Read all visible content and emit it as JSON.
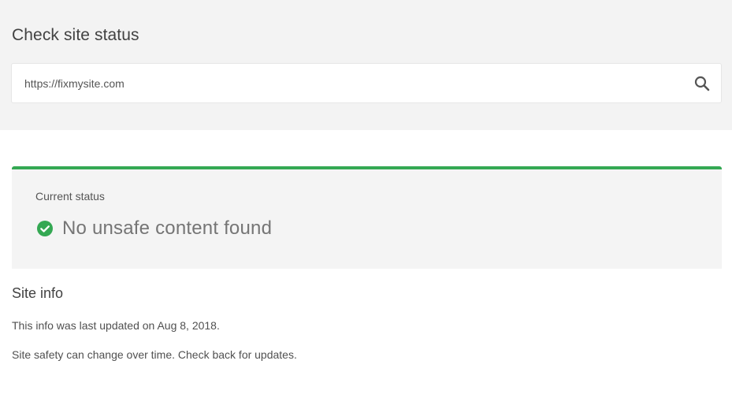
{
  "search": {
    "title": "Check site status",
    "value": "https://fixmysite.com",
    "icon": "search-icon"
  },
  "status": {
    "label": "Current status",
    "text": "No unsafe content found",
    "icon": "check-circle-icon",
    "accent_color": "#34a853"
  },
  "site_info": {
    "title": "Site info",
    "last_updated": "This info was last updated on Aug 8, 2018.",
    "note": "Site safety can change over time. Check back for updates."
  }
}
